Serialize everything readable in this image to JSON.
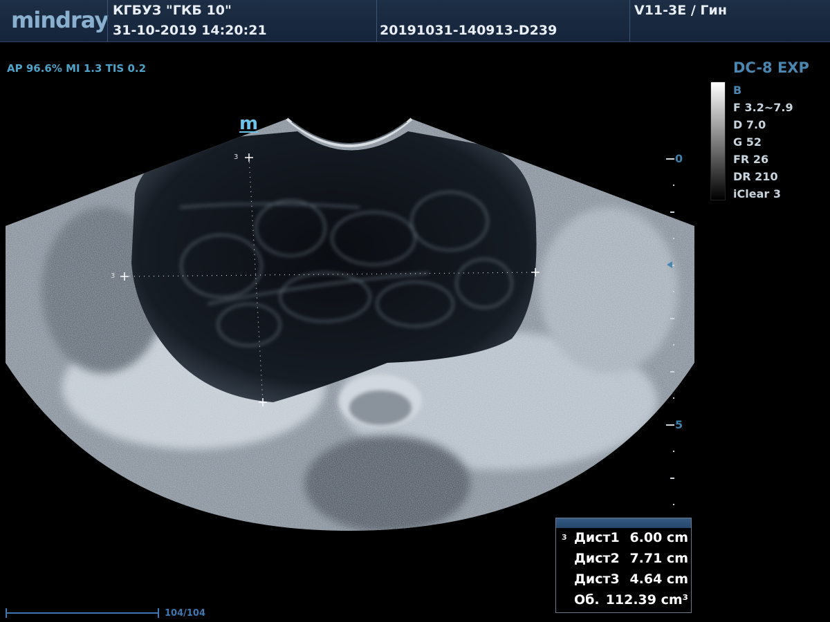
{
  "header": {
    "logo": "mindray",
    "institution": "КГБУЗ \"ГКБ 10\"",
    "datetime": "31-10-2019  14:20:21",
    "exam_id": "20191031-140913-D239",
    "probe_preset": "V11-3E / Гин"
  },
  "acoustic_info": "AP 96.6%  MI 1.3 TIS 0.2",
  "orientation_mark": "m",
  "imaging_params": {
    "preset": "DC-8 EXP",
    "mode": "B",
    "items": [
      "F 3.2~7.9",
      "D 7.0",
      "G 52",
      "FR 26",
      "DR 210",
      "iClear 3"
    ]
  },
  "depth_scale": {
    "labels": [
      "0",
      "5"
    ]
  },
  "caliper_index": "3",
  "measurements": {
    "index": "3",
    "rows": [
      {
        "name": "Дист1",
        "value": "6.00 cm"
      },
      {
        "name": "Дист2",
        "value": "7.71 cm"
      },
      {
        "name": "Дист3",
        "value": "4.64 cm"
      },
      {
        "name": "Об.",
        "value": "112.39 cm³"
      }
    ]
  },
  "cine": {
    "counter": "104/104"
  },
  "colors": {
    "header_bg": "#1a2b41",
    "accent_blue": "#4a86b0",
    "caliper": "#ffffff"
  }
}
